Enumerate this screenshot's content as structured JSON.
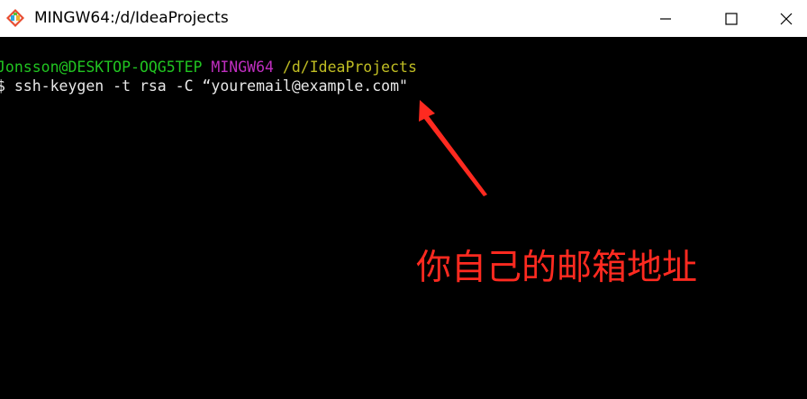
{
  "window": {
    "title": "MINGW64:/d/IdeaProjects",
    "controls": {
      "minimize_icon": "minimize-icon",
      "maximize_icon": "maximize-icon",
      "close_icon": "close-icon"
    },
    "app_icon": "git-bash-icon"
  },
  "terminal": {
    "prompt": {
      "user_host": "Jonsson@DESKTOP-OQG5TEP",
      "shell": "MINGW64",
      "path": "/d/IdeaProjects"
    },
    "command_line": "$ ssh-keygen -t rsa -C “youremail@example.com\""
  },
  "annotation": {
    "text": "你自己的邮箱地址",
    "color": "#ff2a20"
  },
  "colors": {
    "user_host": "#21c421",
    "shell": "#bf2ebf",
    "path": "#c0bd23",
    "terminal_bg": "#000000"
  }
}
